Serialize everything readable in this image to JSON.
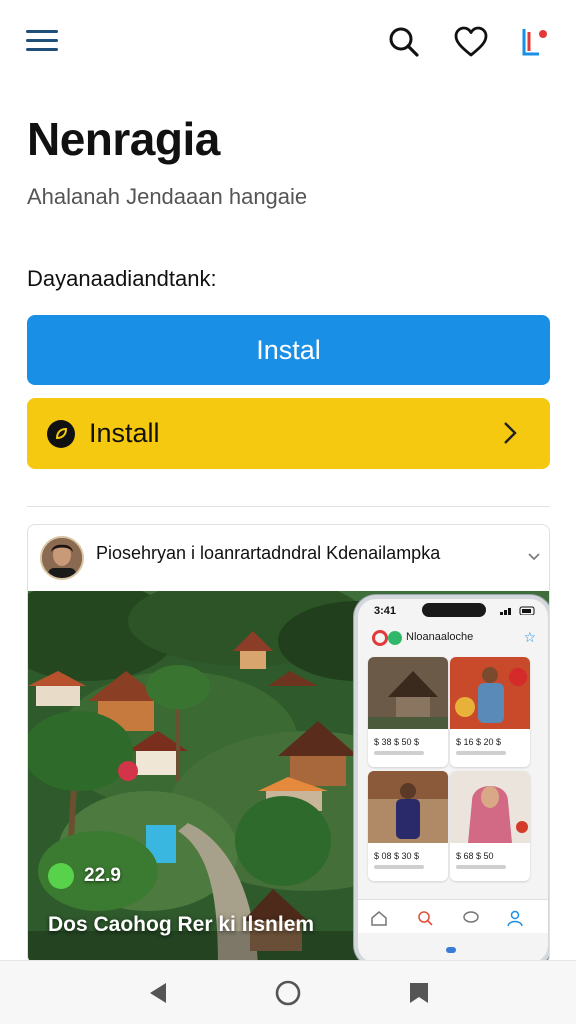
{
  "topbar": {
    "menu_icon": "hamburger-menu-icon",
    "search_icon": "search-icon",
    "favorite_icon": "heart-icon",
    "profile_icon": "notification-l-icon"
  },
  "header": {
    "title": "Nenragia",
    "subtitle": "Ahalanah Jendaaan hangaie"
  },
  "section": {
    "label": "Dayanaadiandtank:"
  },
  "actions": {
    "primary_label": "Instal",
    "secondary_label": "Install",
    "secondary_icon": "leaf-circle-icon",
    "chevron_icon": "chevron-right-icon"
  },
  "post": {
    "title": "Piosehryan i loanrartadndral Kdenailampka",
    "like_count": "22.9",
    "caption": "Dos Caohog Rer ki Ilsnlem"
  },
  "phone": {
    "time": "3:41",
    "app_title": "Nloanaaloche",
    "tiles": [
      {
        "label": "$ 38 $ 50 $"
      },
      {
        "label": "$ 16 $ 20 $"
      },
      {
        "label": "$ 08 $ 30 $"
      },
      {
        "label": "$ 68 $ 50"
      }
    ]
  },
  "colors": {
    "primary": "#1a8fe6",
    "secondary": "#f5c90f",
    "nav_accent": "#1f4e79"
  },
  "navbar": {
    "back_icon": "back-triangle-icon",
    "home_icon": "home-circle-icon",
    "recents_icon": "bookmark-icon"
  }
}
